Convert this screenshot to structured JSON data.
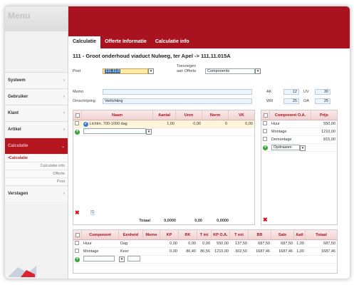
{
  "sidebar": {
    "title": "Menu",
    "items": [
      {
        "label": "Systeem"
      },
      {
        "label": "Gebruiker"
      },
      {
        "label": "Klant"
      },
      {
        "label": "Artikel"
      },
      {
        "label": "Calculatie"
      }
    ],
    "subitems": [
      "•Calculatie",
      "Calculatie info",
      "Offerte",
      "Post"
    ],
    "last_item": "Verslagen"
  },
  "tabs": [
    "Calculatie",
    "Offerte Informatie",
    "Calculatie info"
  ],
  "page_title": "111 - Groot onderhoud viaduct Nulweg, ter Apel -> 111.11.015A",
  "form": {
    "post_label": "Post",
    "post_value": "111.11.0",
    "toevoegen_label_1": "Toevoegen",
    "toevoegen_label_2": "aan Offerte",
    "components_value": "Components",
    "memo_label": "Memo",
    "omschrijving_label": "Omschrijving",
    "omschrijving_value": "Verlichting",
    "ak_label": "AK",
    "ak_value": "12",
    "uv_label": "UV",
    "uv_value": "30",
    "wr_label": "WR",
    "wr_value": "25",
    "oa_label": "OA",
    "oa_value": "25"
  },
  "grid1": {
    "headers": [
      "Naam",
      "Aantal",
      "Uren",
      "Norm",
      "VK"
    ],
    "row": {
      "naam": "Lichtm. 700-1000 dag",
      "aantal": "1,00",
      "uren": "0,00",
      "norm": "0",
      "vk": "0,00"
    },
    "footer": {
      "label": "Totaal",
      "aantal": "0,0000",
      "uren": "0,00",
      "norm": "0,0000"
    }
  },
  "grid2": {
    "headers": [
      "Component O.A.",
      "Prijs"
    ],
    "rows": [
      {
        "name": "Huur",
        "prijs": "550,00"
      },
      {
        "name": "Montage",
        "prijs": "1210,00"
      },
      {
        "name": "Demontage",
        "prijs": "815,00"
      }
    ],
    "add_value": "Opdraaien"
  },
  "grid3": {
    "headers": [
      "Component",
      "Eenheid",
      "Memo",
      "KP",
      "RK",
      "T int",
      "KP O.A.",
      "T ext",
      "BR",
      "Sale",
      "Aatl",
      "Totaal"
    ],
    "rows": [
      [
        "Huur",
        "Dag",
        "",
        "0,00",
        "0,00",
        "0,00",
        "550,00",
        "137,50",
        "687,50",
        "687,50",
        "1,00",
        "687,50"
      ],
      [
        "Montage",
        "Keer",
        "",
        "0,00",
        "86,40",
        "86,56",
        "1210,00",
        "302,50",
        "1687,46",
        "1687,46",
        "1,00",
        "1687,46"
      ]
    ]
  },
  "colors": {
    "accent": "#a8131f",
    "header_bg": "#f1d2d2"
  }
}
